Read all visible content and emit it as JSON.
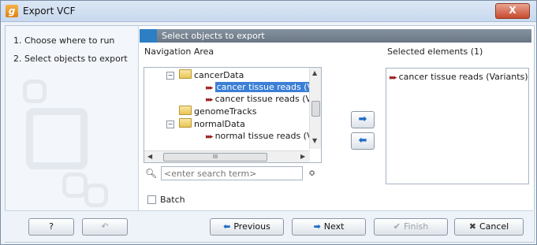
{
  "window": {
    "title": "Export VCF",
    "app_icon": "clc-logo-icon",
    "close_glyph": "X"
  },
  "steps": [
    {
      "label": "1.  Choose where to run"
    },
    {
      "label": "2.  Select objects to export"
    }
  ],
  "panel": {
    "header": "Select objects to export",
    "nav_label": "Navigation Area",
    "selected_label": "Selected elements (1)"
  },
  "tree": {
    "items": [
      {
        "label": "cancerData",
        "icon": "folder-icon",
        "expanded": true
      },
      {
        "label": "cancer tissue reads (Varia",
        "icon": "variant-track-icon",
        "selected": true
      },
      {
        "label": "cancer tissue reads (Varia",
        "icon": "variant-track-icon"
      },
      {
        "label": "genomeTracks",
        "icon": "folder-icon"
      },
      {
        "label": "normalData",
        "icon": "folder-icon",
        "expanded": true
      },
      {
        "label": "normal tissue reads (Varia",
        "icon": "variant-track-icon"
      }
    ],
    "hscroll_thumb": "III"
  },
  "search": {
    "placeholder": "<enter search term>"
  },
  "selected_elements": [
    {
      "label": "cancer tissue reads (Variants)"
    }
  ],
  "batch": {
    "label": "Batch",
    "checked": false
  },
  "footer": {
    "help_label": "?",
    "previous_label": "Previous",
    "next_label": "Next",
    "finish_label": "Finish",
    "cancel_label": "Cancel"
  },
  "colors": {
    "accent": "#2d7fc4",
    "selection": "#3b7fd6"
  }
}
